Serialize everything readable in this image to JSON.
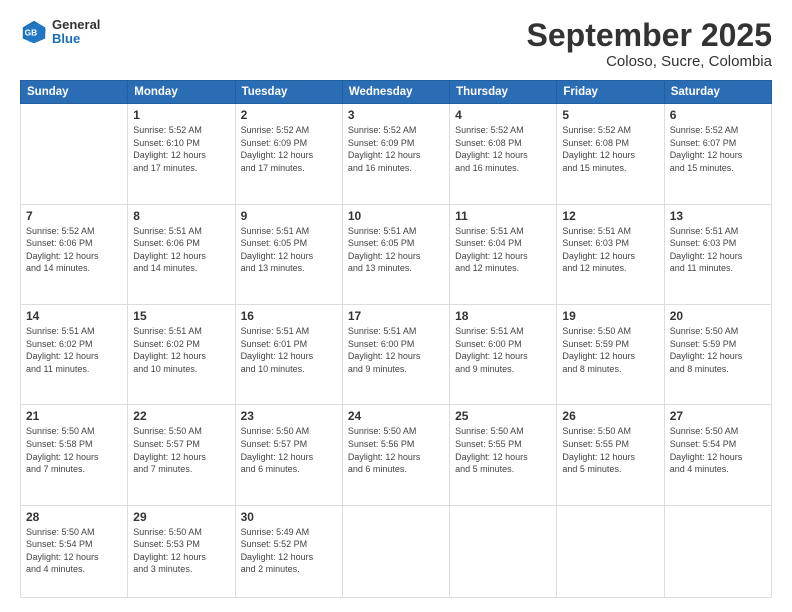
{
  "header": {
    "logo": {
      "general": "General",
      "blue": "Blue"
    },
    "title": "September 2025",
    "subtitle": "Coloso, Sucre, Colombia"
  },
  "calendar": {
    "days_of_week": [
      "Sunday",
      "Monday",
      "Tuesday",
      "Wednesday",
      "Thursday",
      "Friday",
      "Saturday"
    ],
    "weeks": [
      [
        {
          "day": "",
          "info": ""
        },
        {
          "day": "1",
          "info": "Sunrise: 5:52 AM\nSunset: 6:10 PM\nDaylight: 12 hours\nand 17 minutes."
        },
        {
          "day": "2",
          "info": "Sunrise: 5:52 AM\nSunset: 6:09 PM\nDaylight: 12 hours\nand 17 minutes."
        },
        {
          "day": "3",
          "info": "Sunrise: 5:52 AM\nSunset: 6:09 PM\nDaylight: 12 hours\nand 16 minutes."
        },
        {
          "day": "4",
          "info": "Sunrise: 5:52 AM\nSunset: 6:08 PM\nDaylight: 12 hours\nand 16 minutes."
        },
        {
          "day": "5",
          "info": "Sunrise: 5:52 AM\nSunset: 6:08 PM\nDaylight: 12 hours\nand 15 minutes."
        },
        {
          "day": "6",
          "info": "Sunrise: 5:52 AM\nSunset: 6:07 PM\nDaylight: 12 hours\nand 15 minutes."
        }
      ],
      [
        {
          "day": "7",
          "info": "Sunrise: 5:52 AM\nSunset: 6:06 PM\nDaylight: 12 hours\nand 14 minutes."
        },
        {
          "day": "8",
          "info": "Sunrise: 5:51 AM\nSunset: 6:06 PM\nDaylight: 12 hours\nand 14 minutes."
        },
        {
          "day": "9",
          "info": "Sunrise: 5:51 AM\nSunset: 6:05 PM\nDaylight: 12 hours\nand 13 minutes."
        },
        {
          "day": "10",
          "info": "Sunrise: 5:51 AM\nSunset: 6:05 PM\nDaylight: 12 hours\nand 13 minutes."
        },
        {
          "day": "11",
          "info": "Sunrise: 5:51 AM\nSunset: 6:04 PM\nDaylight: 12 hours\nand 12 minutes."
        },
        {
          "day": "12",
          "info": "Sunrise: 5:51 AM\nSunset: 6:03 PM\nDaylight: 12 hours\nand 12 minutes."
        },
        {
          "day": "13",
          "info": "Sunrise: 5:51 AM\nSunset: 6:03 PM\nDaylight: 12 hours\nand 11 minutes."
        }
      ],
      [
        {
          "day": "14",
          "info": "Sunrise: 5:51 AM\nSunset: 6:02 PM\nDaylight: 12 hours\nand 11 minutes."
        },
        {
          "day": "15",
          "info": "Sunrise: 5:51 AM\nSunset: 6:02 PM\nDaylight: 12 hours\nand 10 minutes."
        },
        {
          "day": "16",
          "info": "Sunrise: 5:51 AM\nSunset: 6:01 PM\nDaylight: 12 hours\nand 10 minutes."
        },
        {
          "day": "17",
          "info": "Sunrise: 5:51 AM\nSunset: 6:00 PM\nDaylight: 12 hours\nand 9 minutes."
        },
        {
          "day": "18",
          "info": "Sunrise: 5:51 AM\nSunset: 6:00 PM\nDaylight: 12 hours\nand 9 minutes."
        },
        {
          "day": "19",
          "info": "Sunrise: 5:50 AM\nSunset: 5:59 PM\nDaylight: 12 hours\nand 8 minutes."
        },
        {
          "day": "20",
          "info": "Sunrise: 5:50 AM\nSunset: 5:59 PM\nDaylight: 12 hours\nand 8 minutes."
        }
      ],
      [
        {
          "day": "21",
          "info": "Sunrise: 5:50 AM\nSunset: 5:58 PM\nDaylight: 12 hours\nand 7 minutes."
        },
        {
          "day": "22",
          "info": "Sunrise: 5:50 AM\nSunset: 5:57 PM\nDaylight: 12 hours\nand 7 minutes."
        },
        {
          "day": "23",
          "info": "Sunrise: 5:50 AM\nSunset: 5:57 PM\nDaylight: 12 hours\nand 6 minutes."
        },
        {
          "day": "24",
          "info": "Sunrise: 5:50 AM\nSunset: 5:56 PM\nDaylight: 12 hours\nand 6 minutes."
        },
        {
          "day": "25",
          "info": "Sunrise: 5:50 AM\nSunset: 5:55 PM\nDaylight: 12 hours\nand 5 minutes."
        },
        {
          "day": "26",
          "info": "Sunrise: 5:50 AM\nSunset: 5:55 PM\nDaylight: 12 hours\nand 5 minutes."
        },
        {
          "day": "27",
          "info": "Sunrise: 5:50 AM\nSunset: 5:54 PM\nDaylight: 12 hours\nand 4 minutes."
        }
      ],
      [
        {
          "day": "28",
          "info": "Sunrise: 5:50 AM\nSunset: 5:54 PM\nDaylight: 12 hours\nand 4 minutes."
        },
        {
          "day": "29",
          "info": "Sunrise: 5:50 AM\nSunset: 5:53 PM\nDaylight: 12 hours\nand 3 minutes."
        },
        {
          "day": "30",
          "info": "Sunrise: 5:49 AM\nSunset: 5:52 PM\nDaylight: 12 hours\nand 2 minutes."
        },
        {
          "day": "",
          "info": ""
        },
        {
          "day": "",
          "info": ""
        },
        {
          "day": "",
          "info": ""
        },
        {
          "day": "",
          "info": ""
        }
      ]
    ]
  }
}
